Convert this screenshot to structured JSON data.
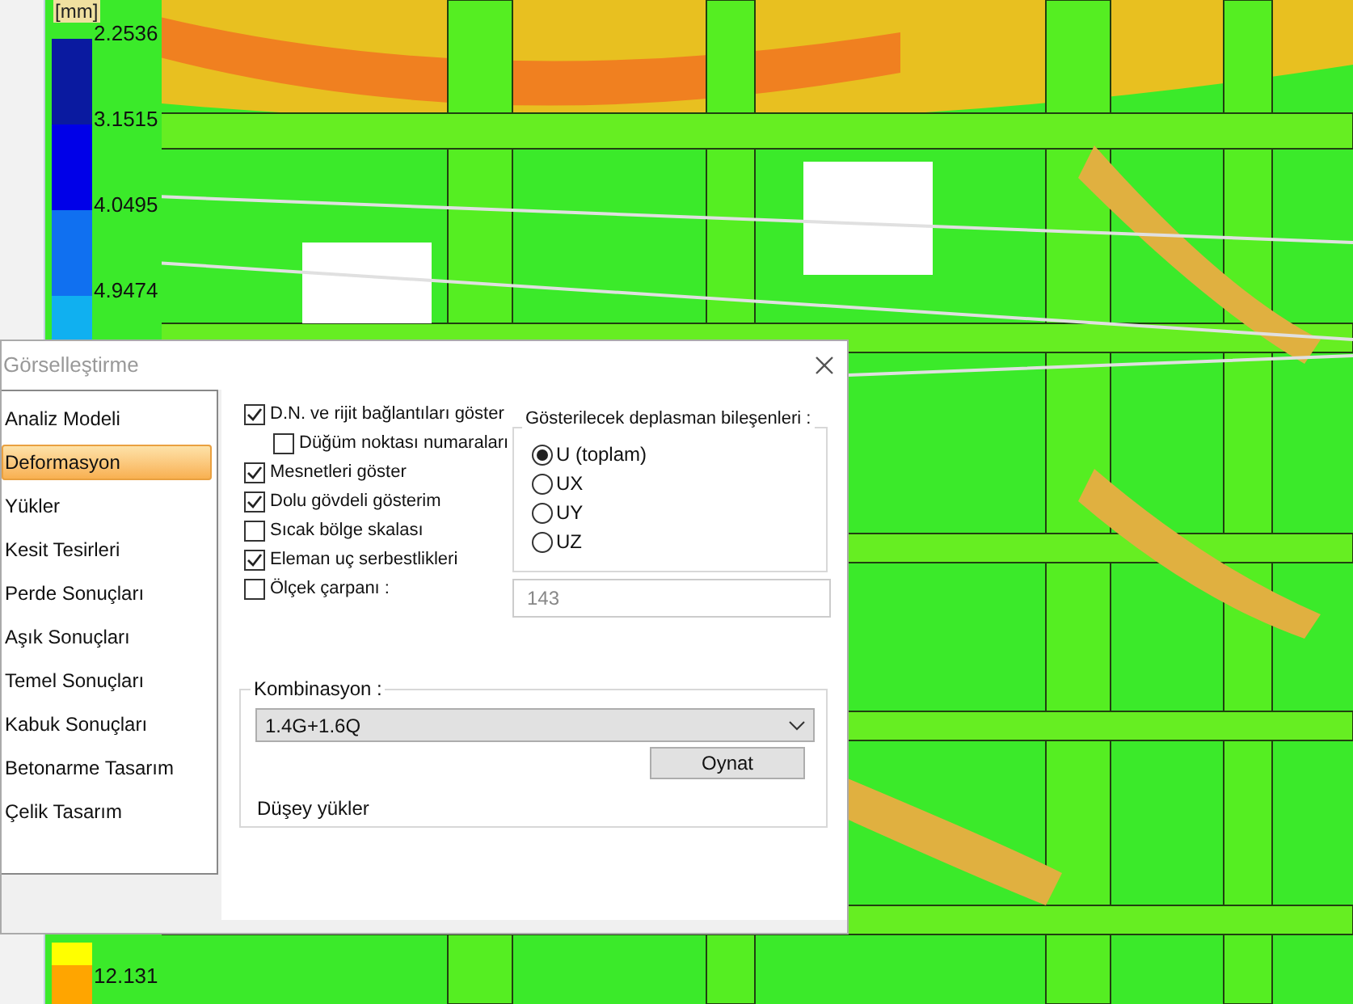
{
  "legend": {
    "unit": "[mm]",
    "values": [
      "2.2536",
      "3.1515",
      "4.0495",
      "4.9474",
      "12.131"
    ]
  },
  "dialog": {
    "title": "Görselleştirme",
    "sidebar": {
      "items": [
        {
          "label": "Analiz Modeli",
          "selected": false
        },
        {
          "label": "Deformasyon",
          "selected": true
        },
        {
          "label": "Yükler",
          "selected": false
        },
        {
          "label": "Kesit Tesirleri",
          "selected": false
        },
        {
          "label": "Perde Sonuçları",
          "selected": false
        },
        {
          "label": "Aşık Sonuçları",
          "selected": false
        },
        {
          "label": "Temel Sonuçları",
          "selected": false
        },
        {
          "label": "Kabuk Sonuçları",
          "selected": false
        },
        {
          "label": "Betonarme Tasarım",
          "selected": false
        },
        {
          "label": "Çelik Tasarım",
          "selected": false
        }
      ]
    },
    "options": [
      {
        "label": "D.N. ve rijit bağlantıları göster",
        "checked": true,
        "children": [
          {
            "label": "Düğüm noktası numaraları",
            "checked": false
          }
        ]
      },
      {
        "label": "Mesnetleri göster",
        "checked": true
      },
      {
        "label": "Dolu gövdeli gösterim",
        "checked": true
      },
      {
        "label": "Sıcak bölge skalası",
        "checked": false
      },
      {
        "label": "Eleman uç serbestlikleri",
        "checked": true
      },
      {
        "label": "Ölçek çarpanı :",
        "checked": false
      }
    ],
    "scale_value": "143",
    "displacement": {
      "title": "Gösterilecek deplasman bileşenleri :",
      "options": [
        {
          "label": "U (toplam)",
          "selected": true
        },
        {
          "label": "UX",
          "selected": false
        },
        {
          "label": "UY",
          "selected": false
        },
        {
          "label": "UZ",
          "selected": false
        }
      ]
    },
    "combination": {
      "title": "Kombinasyon :",
      "value": "1.4G+1.6Q",
      "button": "Oynat",
      "description": "Düşey yükler"
    }
  }
}
